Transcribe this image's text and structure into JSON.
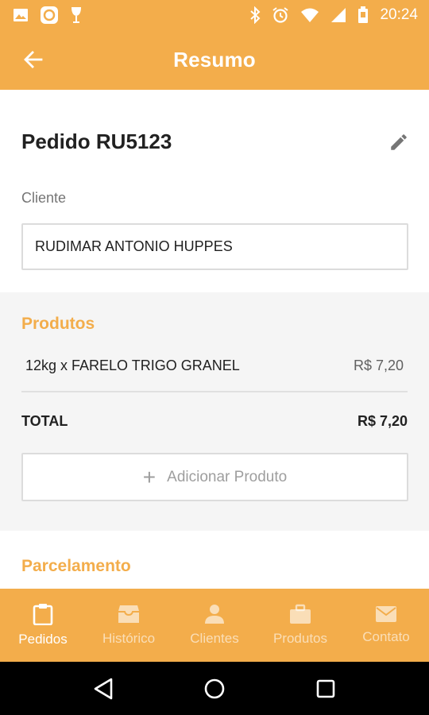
{
  "status_bar": {
    "time": "20:24",
    "left_icons": [
      "image-icon",
      "app-notification-icon",
      "wine-glass-icon"
    ],
    "right_icons": [
      "bluetooth-icon",
      "alarm-icon",
      "wifi-icon",
      "signal-icon",
      "battery-icon"
    ]
  },
  "app_bar": {
    "title": "Resumo",
    "back_icon": "arrow-left-icon"
  },
  "order": {
    "title": "Pedido RU5123",
    "edit_icon": "pencil-icon",
    "client_label": "Cliente",
    "client_value": "RUDIMAR ANTONIO HUPPES"
  },
  "products": {
    "title": "Produtos",
    "items": [
      {
        "description": "12kg x FARELO TRIGO GRANEL",
        "price": "R$ 7,20"
      }
    ],
    "total_label": "TOTAL",
    "total_value": "R$ 7,20",
    "add_button_label": "Adicionar Produto",
    "add_icon": "plus-icon"
  },
  "installments": {
    "title": "Parcelamento"
  },
  "bottom_nav": {
    "items": [
      {
        "label": "Pedidos",
        "icon": "clipboard-icon",
        "active": true
      },
      {
        "label": "Histórico",
        "icon": "archive-icon",
        "active": false
      },
      {
        "label": "Clientes",
        "icon": "person-icon",
        "active": false
      },
      {
        "label": "Produtos",
        "icon": "briefcase-icon",
        "active": false
      },
      {
        "label": "Contato",
        "icon": "mail-icon",
        "active": false
      }
    ]
  },
  "system_nav": {
    "buttons": [
      "back-triangle-icon",
      "home-circle-icon",
      "recents-square-icon"
    ]
  },
  "colors": {
    "accent": "#f3ad4b",
    "background": "#ffffff",
    "section_background": "#f5f5f5",
    "text": "#212121"
  }
}
